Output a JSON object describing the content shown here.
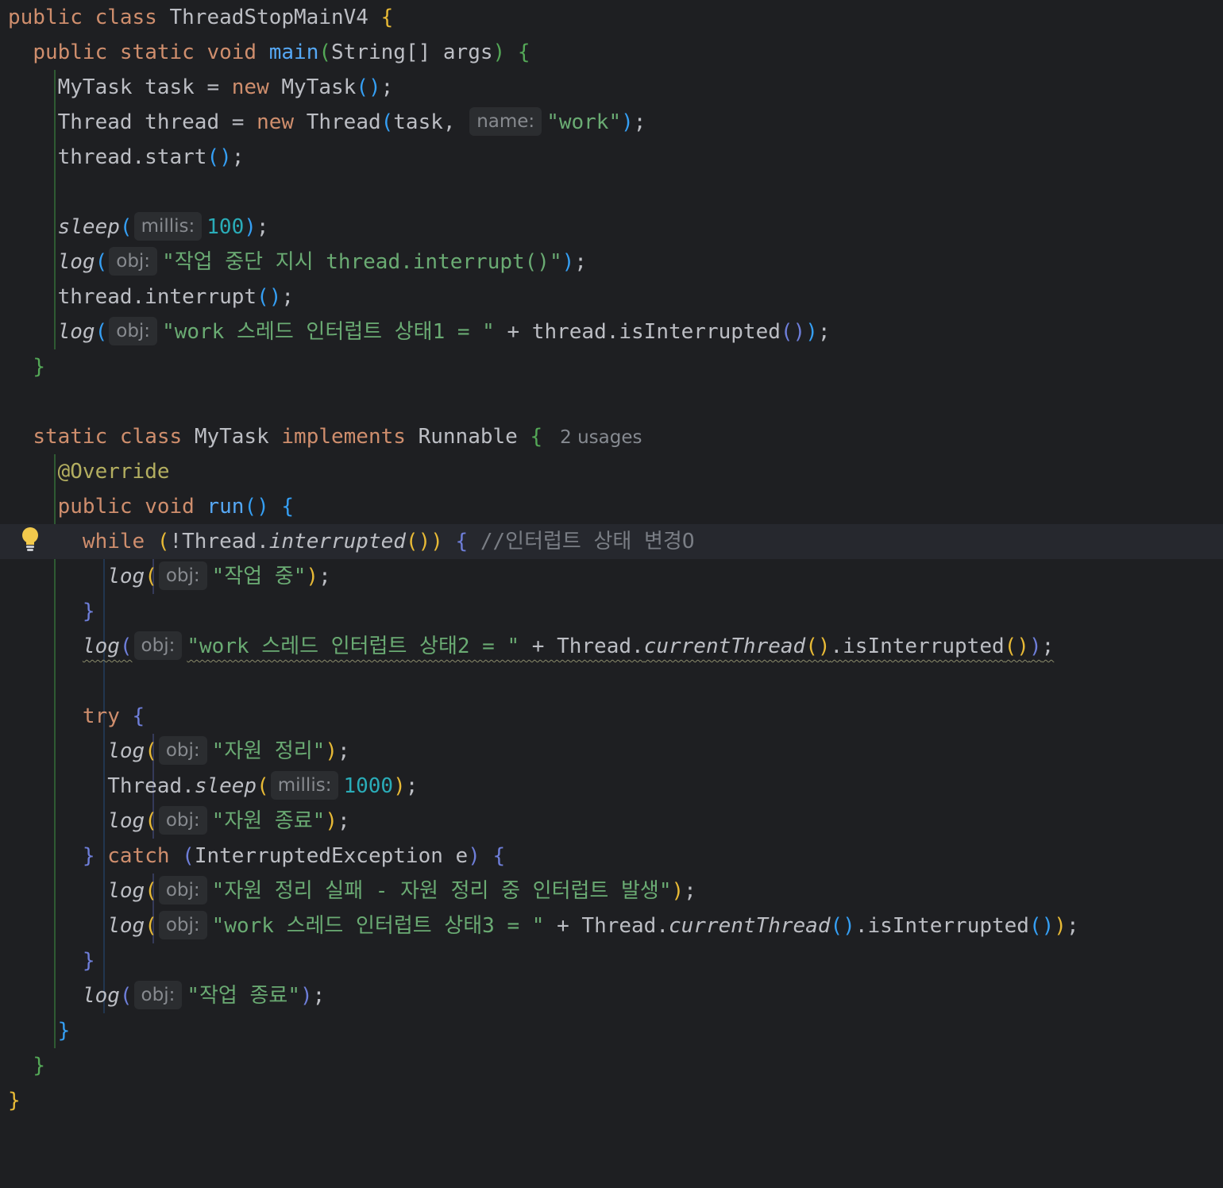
{
  "colors": {
    "background": "#1e1f22",
    "current_line": "#26282e",
    "keyword": "#cf8e6d",
    "method": "#56a8f5",
    "string": "#6aab73",
    "number": "#2aacb8",
    "annotation": "#b3ae60",
    "comment": "#7a7e85",
    "bracket_level_1": "#e8ba36",
    "bracket_level_2": "#54a857",
    "bracket_level_3": "#359ff4",
    "bracket_level_4": "#6e7ed9"
  },
  "icons": {
    "gutter": "lightbulb-icon"
  },
  "hints": {
    "name": "name:",
    "millis": "millis:",
    "obj": "obj:",
    "usages": "2 usages"
  },
  "code": {
    "class_name": "ThreadStopMainV4",
    "thread_name": "\"work\"",
    "sleep_main": "100",
    "sleep_worker": "1000",
    "msg_interrupt_order": "\"작업 중단 지시 thread.interrupt()\"",
    "msg_state1": "\"work 스레드 인터럽트 상태1 = \"",
    "comment_while": "//인터럽트 상태 변경O",
    "msg_working": "\"작업 중\"",
    "msg_state2": "\"work 스레드 인터럽트 상태2 = \"",
    "msg_cleanup": "\"자원 정리\"",
    "msg_cleanup_end": "\"자원 종료\"",
    "msg_cleanup_fail": "\"자원 정리 실패 - 자원 정리 중 인터럽트 발생\"",
    "msg_state3": "\"work 스레드 인터럽트 상태3 = \"",
    "msg_task_end": "\"작업 종료\""
  }
}
